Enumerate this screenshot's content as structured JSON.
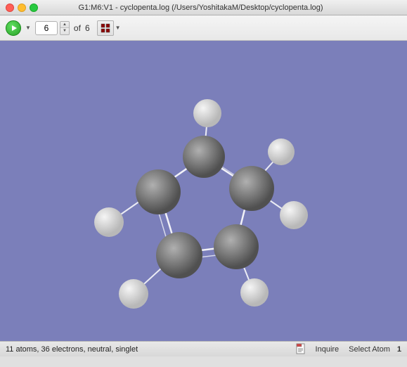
{
  "titleBar": {
    "title": "G1:M6:V1 - cyclopenta.log (/Users/YoshitakaM/Desktop/cyclopenta.log)"
  },
  "toolbar": {
    "currentStep": "6",
    "ofLabel": "of",
    "totalSteps": "6",
    "spinnerUp": "▲",
    "spinnerDown": "▼",
    "dropdownArrow": "▼"
  },
  "statusBar": {
    "info": "11 atoms, 36 electrons, neutral, singlet",
    "inquireLabel": "Inquire",
    "selectAtomLabel": "Select Atom",
    "selectAtomNum": "1"
  },
  "viewport": {
    "background": "#7b7fba"
  }
}
